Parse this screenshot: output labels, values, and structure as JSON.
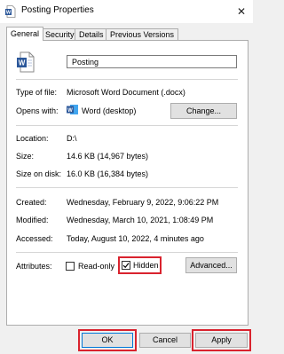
{
  "window": {
    "title": "Posting Properties",
    "close_glyph": "✕"
  },
  "tabs": [
    {
      "label": "General"
    },
    {
      "label": "Security"
    },
    {
      "label": "Details"
    },
    {
      "label": "Previous Versions"
    }
  ],
  "general": {
    "file_name": "Posting",
    "type_label": "Type of file:",
    "type_value": "Microsoft Word Document (.docx)",
    "opens_label": "Opens with:",
    "opens_value": "Word (desktop)",
    "change_label": "Change...",
    "location_label": "Location:",
    "location_value": "D:\\",
    "size_label": "Size:",
    "size_value": "14.6 KB (14,967 bytes)",
    "size_disk_label": "Size on disk:",
    "size_disk_value": "16.0 KB (16,384 bytes)",
    "created_label": "Created:",
    "created_value": "Wednesday, February 9, 2022, 9:06:22 PM",
    "modified_label": "Modified:",
    "modified_value": "Wednesday, March 10, 2021, 1:08:49 PM",
    "accessed_label": "Accessed:",
    "accessed_value": "Today, August 10, 2022, 4 minutes ago",
    "attributes_label": "Attributes:",
    "readonly_label": "Read-only",
    "readonly_checked": false,
    "hidden_label": "Hidden",
    "hidden_checked": true,
    "advanced_label": "Advanced..."
  },
  "footer": {
    "ok_label": "OK",
    "cancel_label": "Cancel",
    "apply_label": "Apply"
  },
  "colors": {
    "highlight": "#d9232e",
    "word_blue": "#2b579a"
  },
  "icons": {
    "file_icon": "word-document-icon",
    "app_icon": "word-app-icon"
  }
}
